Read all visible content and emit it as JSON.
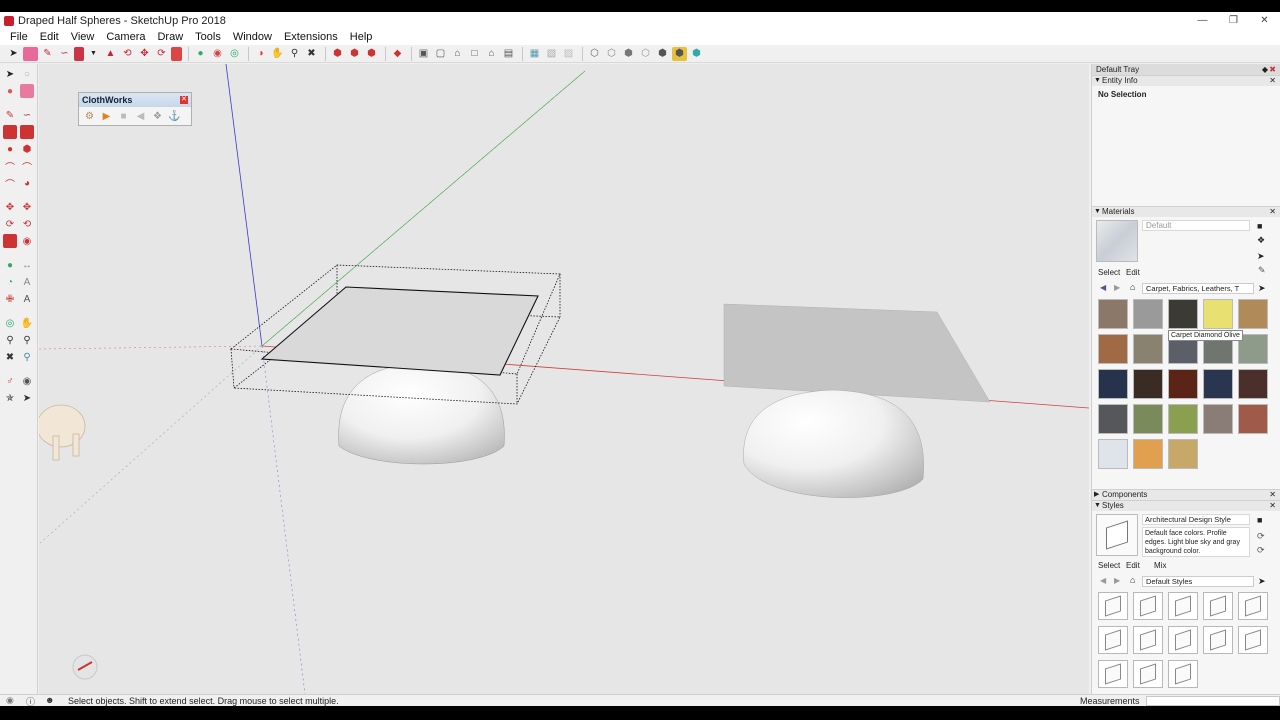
{
  "window": {
    "title": "Draped Half Spheres - SketchUp Pro 2018",
    "controls": [
      "minimize",
      "restore",
      "close"
    ]
  },
  "menu": [
    "File",
    "Edit",
    "View",
    "Camera",
    "Draw",
    "Tools",
    "Window",
    "Extensions",
    "Help"
  ],
  "clothworks": {
    "title": "ClothWorks"
  },
  "tray": {
    "title": "Default Tray",
    "entity_info": {
      "header": "Entity Info",
      "selection": "No Selection"
    },
    "materials": {
      "header": "Materials",
      "current_name": "Default",
      "tab_select": "Select",
      "tab_edit": "Edit",
      "library": "Carpet, Fabrics, Leathers, T",
      "tooltip": "Carpet Diamond Olive",
      "swatch_colors": [
        "#8c7868",
        "#9a9a9a",
        "#3b3a34",
        "#e8e070",
        "#b08a58",
        "#a06a45",
        "#8a8270",
        "#5a5f68",
        "#6f7670",
        "#8e9a8a",
        "#27324d",
        "#3a2c25",
        "#5a2416",
        "#2a3550",
        "#4a2f2a",
        "#55575a",
        "#7b8a5a",
        "#8aa050",
        "#8a7d78",
        "#a05a4a",
        "#dfe3ea",
        "#e0a050",
        "#c8a868"
      ]
    },
    "components": {
      "header": "Components"
    },
    "styles": {
      "header": "Styles",
      "name": "Architectural Design Style",
      "description": "Default face colors. Profile edges. Light blue sky and gray background color.",
      "tab_select": "Select",
      "tab_edit": "Edit",
      "tab_mix": "Mix",
      "library": "Default Styles"
    }
  },
  "status": {
    "hint": "Select objects. Shift to extend select. Drag mouse to select multiple.",
    "measurements_label": "Measurements"
  }
}
